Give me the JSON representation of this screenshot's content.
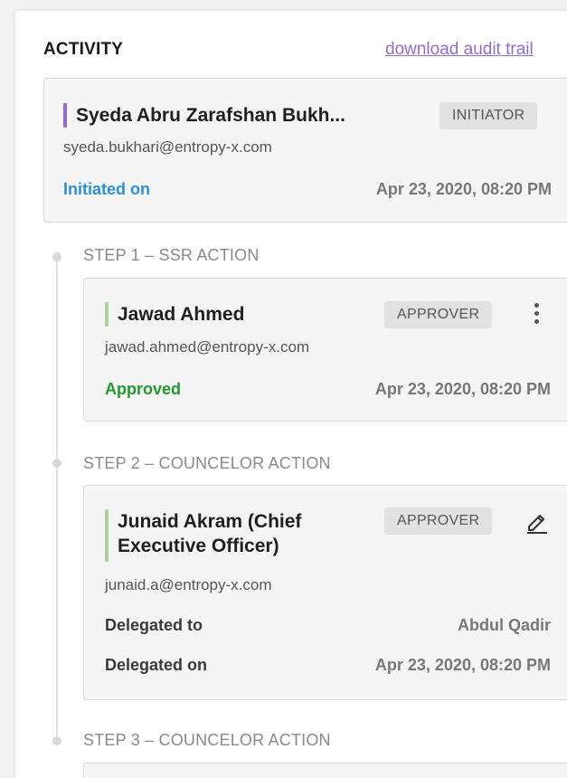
{
  "header": {
    "title": "ACTIVITY",
    "audit_link": "download audit trail"
  },
  "initiator": {
    "name": "Syeda Abru Zarafshan Bukh...",
    "badge": "INITIATOR",
    "email": "syeda.bukhari@entropy-x.com",
    "status_label": "Initiated on",
    "date": "Apr 23, 2020, 08:20 PM"
  },
  "steps": [
    {
      "label": "STEP 1 – SSR ACTION",
      "name": "Jawad Ahmed",
      "badge": "APPROVER",
      "email": "jawad.ahmed@entropy-x.com",
      "status_label": "Approved",
      "date": "Apr 23, 2020, 08:20 PM"
    },
    {
      "label": "STEP 2 – COUNCELOR ACTION",
      "name_line1": "Junaid Akram (Chief",
      "name_line2": "Executive Officer)",
      "badge": "APPROVER",
      "email": "junaid.a@entropy-x.com",
      "delegated_to_label": "Delegated to",
      "delegated_to_value": "Abdul Qadir",
      "delegated_on_label": "Delegated on",
      "delegated_on_value": "Apr 23, 2020, 08:20 PM"
    },
    {
      "label": "STEP 3 – COUNCELOR ACTION"
    }
  ],
  "colors": {
    "initiator_bar": "#8c6fd1",
    "approver_bar": "#a8d39b",
    "initiated_text": "#2b8fe0",
    "approved_text": "#1f9a2e",
    "link": "#8c6fd1"
  },
  "icons": {
    "more": "kebab-menu-icon",
    "edit": "pencil-icon"
  }
}
